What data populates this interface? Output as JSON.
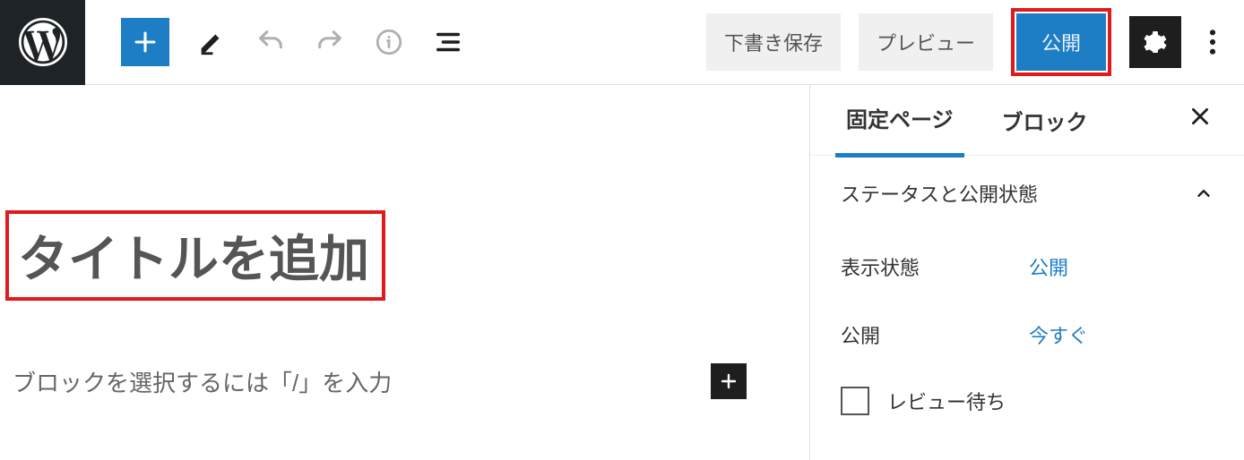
{
  "toolbar": {
    "save_draft": "下書き保存",
    "preview": "プレビュー",
    "publish": "公開"
  },
  "editor": {
    "title_placeholder": "タイトルを追加",
    "block_placeholder": "ブロックを選択するには「/」を入力"
  },
  "sidebar": {
    "tabs": {
      "page": "固定ページ",
      "block": "ブロック"
    },
    "panel_status_title": "ステータスと公開状態",
    "visibility": {
      "label": "表示状態",
      "value": "公開"
    },
    "publish": {
      "label": "公開",
      "value": "今すぐ"
    },
    "pending_review": "レビュー待ち"
  }
}
